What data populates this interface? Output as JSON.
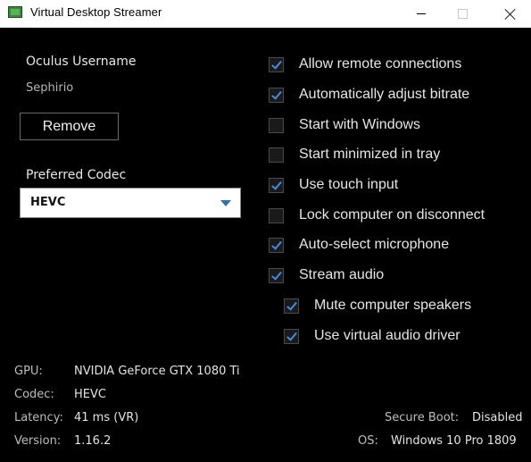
{
  "window": {
    "title": "Virtual Desktop Streamer",
    "icon": "monitor-app-icon"
  },
  "account": {
    "label": "Oculus Username",
    "username": "Sephirio",
    "remove_label": "Remove"
  },
  "codec": {
    "label": "Preferred Codec",
    "selected": "HEVC"
  },
  "options": [
    {
      "label": "Allow remote connections",
      "checked": true
    },
    {
      "label": "Automatically adjust bitrate",
      "checked": true
    },
    {
      "label": "Start with Windows",
      "checked": false
    },
    {
      "label": "Start minimized in tray",
      "checked": false
    },
    {
      "label": "Use touch input",
      "checked": true
    },
    {
      "label": "Lock computer on disconnect",
      "checked": false
    },
    {
      "label": "Auto-select microphone",
      "checked": true
    },
    {
      "label": "Stream audio",
      "checked": true
    },
    {
      "label": "Mute computer speakers",
      "checked": true
    },
    {
      "label": "Use virtual audio driver",
      "checked": true
    }
  ],
  "info": {
    "gpu_label": "GPU:",
    "gpu_value": "NVIDIA GeForce GTX 1080 Ti",
    "codec_label": "Codec:",
    "codec_value": "HEVC",
    "latency_label": "Latency:",
    "latency_value": "41 ms (VR)",
    "version_label": "Version:",
    "version_value": "1.16.2",
    "secure_boot_label": "Secure Boot:",
    "secure_boot_value": "Disabled",
    "os_label": "OS:",
    "os_value": "Windows 10 Pro 1809"
  },
  "colors": {
    "background": "#000000",
    "accent": "#3b8de8"
  }
}
